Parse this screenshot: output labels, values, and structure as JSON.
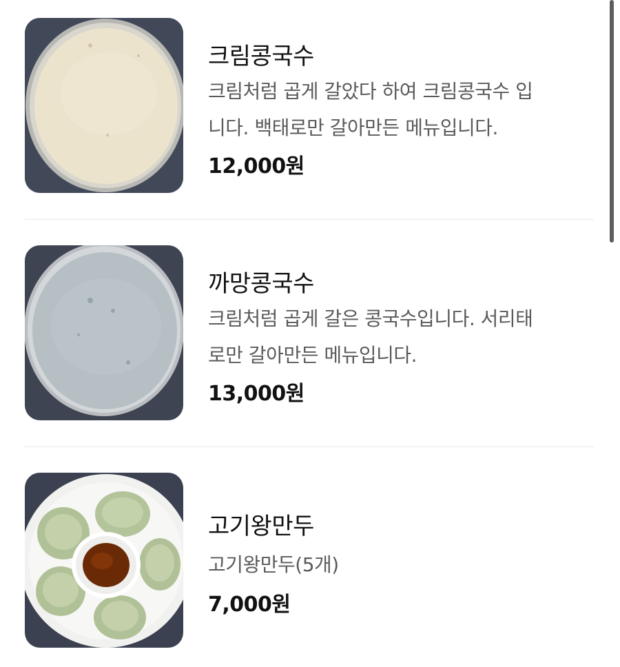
{
  "menu": {
    "items": [
      {
        "name": "크림콩국수",
        "description_lines": [
          "크림처럼 곱게 갈았다 하여 크림콩국수 입",
          "니다. 백태로만 갈아만든 메뉴입니다."
        ],
        "price": "12,000원",
        "image": "cream-soy-noodle-bowl"
      },
      {
        "name": "까망콩국수",
        "description_lines": [
          "크림처럼 곱게 갈은 콩국수입니다. 서리태",
          "로만 갈아만든 메뉴입니다."
        ],
        "price": "13,000원",
        "image": "black-soy-noodle-bowl"
      },
      {
        "name": "고기왕만두",
        "description_lines": [
          "고기왕만두(5개)"
        ],
        "price": "7,000원",
        "image": "meat-dumplings-plate"
      }
    ]
  },
  "colors": {
    "background": "#ffffff",
    "title_text": "#111111",
    "description_text": "#5a5a5a",
    "divider": "#e8e8e8",
    "scrollbar": "#5e5e5e"
  }
}
